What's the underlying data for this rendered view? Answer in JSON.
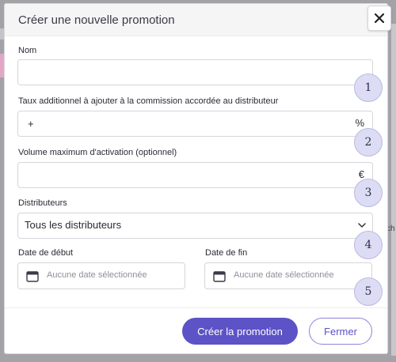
{
  "modal": {
    "title": "Créer une nouvelle promotion",
    "close_symbol": "✕"
  },
  "fields": {
    "name": {
      "label": "Nom",
      "value": ""
    },
    "rate": {
      "label": "Taux additionnel à ajouter à la commission accordée au distributeur",
      "prefix": "+",
      "suffix": "%"
    },
    "volume": {
      "label": "Volume maximum d'activation (optionnel)",
      "suffix": "€"
    },
    "distributors": {
      "label": "Distributeurs",
      "selected": "Tous les distributeurs"
    },
    "start_date": {
      "label": "Date de début",
      "placeholder": "Aucune date sélectionnée"
    },
    "end_date": {
      "label": "Date de fin",
      "placeholder": "Aucune date sélectionnée"
    }
  },
  "badges": [
    "1",
    "2",
    "3",
    "4",
    "5"
  ],
  "buttons": {
    "create": "Créer la promotion",
    "close": "Fermer"
  },
  "background": {
    "right_text": "ch"
  },
  "colors": {
    "primary": "#5d52c6",
    "badge": "#dcdcf5"
  },
  "icons": {
    "close": "close-icon",
    "chevron": "chevron-down-icon",
    "calendar": "calendar-icon"
  }
}
